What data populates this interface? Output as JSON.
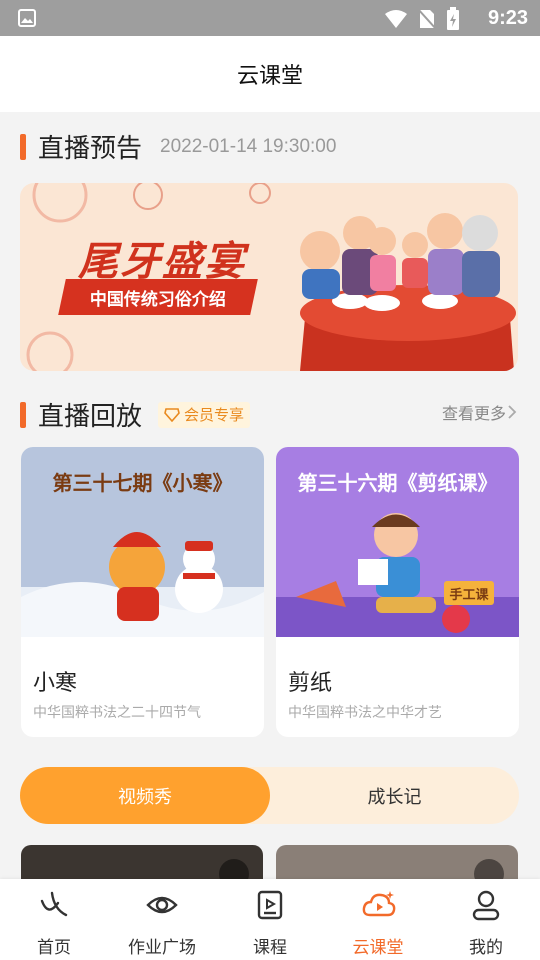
{
  "status_bar": {
    "time": "9:23"
  },
  "header": {
    "title": "云课堂"
  },
  "live_preview": {
    "title": "直播预告",
    "datetime": "2022-01-14 19:30:00",
    "banner_title": "尾牙盛宴",
    "banner_subtitle": "中国传统习俗介绍"
  },
  "replay": {
    "title": "直播回放",
    "badge": "会员专享",
    "more": "查看更多",
    "cards": [
      {
        "caption": "第三十七期《小寒》",
        "name": "小寒",
        "desc": "中华国粹书法之二十四节气"
      },
      {
        "caption": "第三十六期《剪纸课》",
        "name": "剪纸",
        "desc": "中华国粹书法之中华才艺",
        "tag": "手工课"
      }
    ]
  },
  "tabs": {
    "video_show": "视频秀",
    "growth": "成长记"
  },
  "nav": {
    "items": [
      {
        "label": "首页",
        "icon": "home-icon"
      },
      {
        "label": "作业广场",
        "icon": "eye-icon"
      },
      {
        "label": "课程",
        "icon": "book-icon"
      },
      {
        "label": "云课堂",
        "icon": "cloud-play-icon"
      },
      {
        "label": "我的",
        "icon": "user-icon"
      }
    ]
  },
  "colors": {
    "accent": "#f26a2a",
    "tab_active": "#ffa12e"
  }
}
